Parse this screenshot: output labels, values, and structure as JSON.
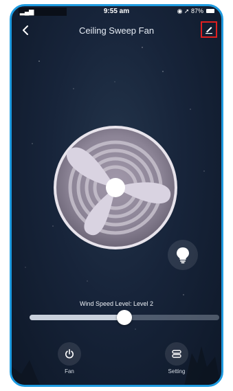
{
  "status_bar": {
    "time": "9:55 am",
    "battery_percent": "87%",
    "icons": [
      "signal-icon",
      "location-icon",
      "battery-icon"
    ]
  },
  "nav": {
    "title": "Ceiling Sweep Fan",
    "back_icon": "chevron-left-icon",
    "edit_icon": "edit-pencil-icon"
  },
  "device": {
    "fan_icon": "fan-blades-icon",
    "light_icon": "light-bulb-icon"
  },
  "wind_speed": {
    "label": "Wind Speed Level: Level 2",
    "level_fraction": 0.5
  },
  "bottom_tabs": [
    {
      "label": "Fan",
      "icon": "power-icon"
    },
    {
      "label": "Setting",
      "icon": "settings-toggle-icon"
    }
  ],
  "colors": {
    "frame_border": "#1e9be0",
    "highlight_box": "#e02020",
    "background": "#17243a"
  }
}
